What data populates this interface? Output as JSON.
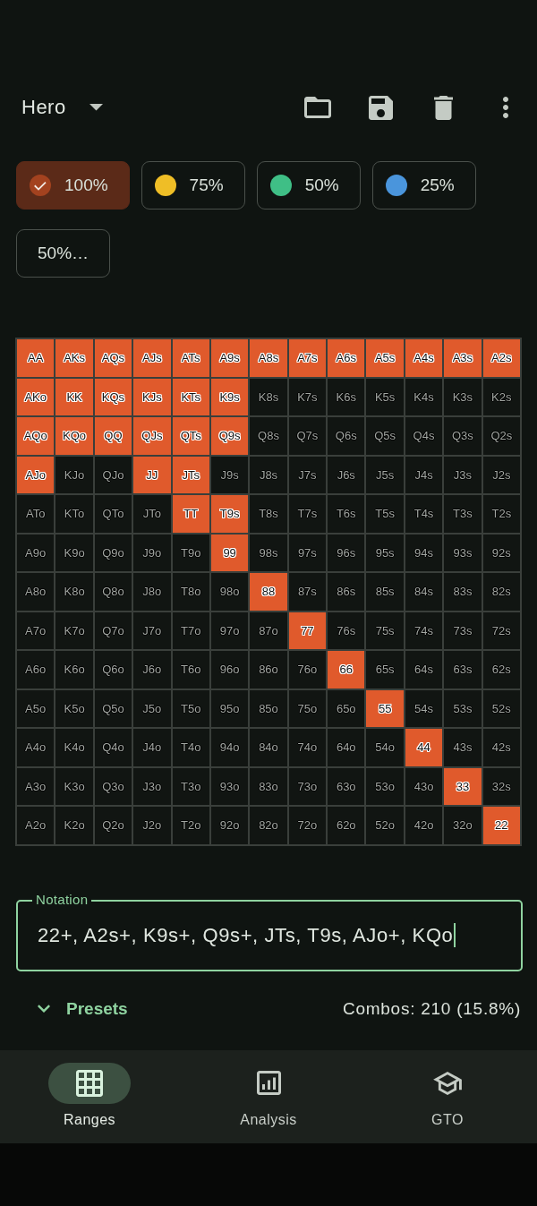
{
  "header": {
    "range_name": "Hero"
  },
  "chips": [
    {
      "label": "100%",
      "kind": "swatch",
      "color": "#a3421f",
      "selected": true
    },
    {
      "label": "75%",
      "kind": "swatch",
      "color": "#efbe26",
      "selected": false
    },
    {
      "label": "50%",
      "kind": "swatch",
      "color": "#3fbf86",
      "selected": false
    },
    {
      "label": "25%",
      "kind": "swatch",
      "color": "#4a95dc",
      "selected": false
    },
    {
      "label": "50%…",
      "kind": "plain",
      "selected": false
    }
  ],
  "range_grid": {
    "rows": [
      {
        "cells": [
          {
            "label": "AA",
            "selected": true
          },
          {
            "label": "AKs",
            "selected": true
          },
          {
            "label": "AQs",
            "selected": true
          },
          {
            "label": "AJs",
            "selected": true
          },
          {
            "label": "ATs",
            "selected": true
          },
          {
            "label": "A9s",
            "selected": true
          },
          {
            "label": "A8s",
            "selected": true
          },
          {
            "label": "A7s",
            "selected": true
          },
          {
            "label": "A6s",
            "selected": true
          },
          {
            "label": "A5s",
            "selected": true
          },
          {
            "label": "A4s",
            "selected": true
          },
          {
            "label": "A3s",
            "selected": true
          },
          {
            "label": "A2s",
            "selected": true
          }
        ]
      },
      {
        "cells": [
          {
            "label": "AKo",
            "selected": true
          },
          {
            "label": "KK",
            "selected": true
          },
          {
            "label": "KQs",
            "selected": true
          },
          {
            "label": "KJs",
            "selected": true
          },
          {
            "label": "KTs",
            "selected": true
          },
          {
            "label": "K9s",
            "selected": true
          },
          {
            "label": "K8s",
            "selected": false
          },
          {
            "label": "K7s",
            "selected": false
          },
          {
            "label": "K6s",
            "selected": false
          },
          {
            "label": "K5s",
            "selected": false
          },
          {
            "label": "K4s",
            "selected": false
          },
          {
            "label": "K3s",
            "selected": false
          },
          {
            "label": "K2s",
            "selected": false
          }
        ]
      },
      {
        "cells": [
          {
            "label": "AQo",
            "selected": true
          },
          {
            "label": "KQo",
            "selected": true
          },
          {
            "label": "QQ",
            "selected": true
          },
          {
            "label": "QJs",
            "selected": true
          },
          {
            "label": "QTs",
            "selected": true
          },
          {
            "label": "Q9s",
            "selected": true
          },
          {
            "label": "Q8s",
            "selected": false
          },
          {
            "label": "Q7s",
            "selected": false
          },
          {
            "label": "Q6s",
            "selected": false
          },
          {
            "label": "Q5s",
            "selected": false
          },
          {
            "label": "Q4s",
            "selected": false
          },
          {
            "label": "Q3s",
            "selected": false
          },
          {
            "label": "Q2s",
            "selected": false
          }
        ]
      },
      {
        "cells": [
          {
            "label": "AJo",
            "selected": true
          },
          {
            "label": "KJo",
            "selected": false
          },
          {
            "label": "QJo",
            "selected": false
          },
          {
            "label": "JJ",
            "selected": true
          },
          {
            "label": "JTs",
            "selected": true
          },
          {
            "label": "J9s",
            "selected": false
          },
          {
            "label": "J8s",
            "selected": false
          },
          {
            "label": "J7s",
            "selected": false
          },
          {
            "label": "J6s",
            "selected": false
          },
          {
            "label": "J5s",
            "selected": false
          },
          {
            "label": "J4s",
            "selected": false
          },
          {
            "label": "J3s",
            "selected": false
          },
          {
            "label": "J2s",
            "selected": false
          }
        ]
      },
      {
        "cells": [
          {
            "label": "ATo",
            "selected": false
          },
          {
            "label": "KTo",
            "selected": false
          },
          {
            "label": "QTo",
            "selected": false
          },
          {
            "label": "JTo",
            "selected": false
          },
          {
            "label": "TT",
            "selected": true
          },
          {
            "label": "T9s",
            "selected": true
          },
          {
            "label": "T8s",
            "selected": false
          },
          {
            "label": "T7s",
            "selected": false
          },
          {
            "label": "T6s",
            "selected": false
          },
          {
            "label": "T5s",
            "selected": false
          },
          {
            "label": "T4s",
            "selected": false
          },
          {
            "label": "T3s",
            "selected": false
          },
          {
            "label": "T2s",
            "selected": false
          }
        ]
      },
      {
        "cells": [
          {
            "label": "A9o",
            "selected": false
          },
          {
            "label": "K9o",
            "selected": false
          },
          {
            "label": "Q9o",
            "selected": false
          },
          {
            "label": "J9o",
            "selected": false
          },
          {
            "label": "T9o",
            "selected": false
          },
          {
            "label": "99",
            "selected": true
          },
          {
            "label": "98s",
            "selected": false
          },
          {
            "label": "97s",
            "selected": false
          },
          {
            "label": "96s",
            "selected": false
          },
          {
            "label": "95s",
            "selected": false
          },
          {
            "label": "94s",
            "selected": false
          },
          {
            "label": "93s",
            "selected": false
          },
          {
            "label": "92s",
            "selected": false
          }
        ]
      },
      {
        "cells": [
          {
            "label": "A8o",
            "selected": false
          },
          {
            "label": "K8o",
            "selected": false
          },
          {
            "label": "Q8o",
            "selected": false
          },
          {
            "label": "J8o",
            "selected": false
          },
          {
            "label": "T8o",
            "selected": false
          },
          {
            "label": "98o",
            "selected": false
          },
          {
            "label": "88",
            "selected": true
          },
          {
            "label": "87s",
            "selected": false
          },
          {
            "label": "86s",
            "selected": false
          },
          {
            "label": "85s",
            "selected": false
          },
          {
            "label": "84s",
            "selected": false
          },
          {
            "label": "83s",
            "selected": false
          },
          {
            "label": "82s",
            "selected": false
          }
        ]
      },
      {
        "cells": [
          {
            "label": "A7o",
            "selected": false
          },
          {
            "label": "K7o",
            "selected": false
          },
          {
            "label": "Q7o",
            "selected": false
          },
          {
            "label": "J7o",
            "selected": false
          },
          {
            "label": "T7o",
            "selected": false
          },
          {
            "label": "97o",
            "selected": false
          },
          {
            "label": "87o",
            "selected": false
          },
          {
            "label": "77",
            "selected": true
          },
          {
            "label": "76s",
            "selected": false
          },
          {
            "label": "75s",
            "selected": false
          },
          {
            "label": "74s",
            "selected": false
          },
          {
            "label": "73s",
            "selected": false
          },
          {
            "label": "72s",
            "selected": false
          }
        ]
      },
      {
        "cells": [
          {
            "label": "A6o",
            "selected": false
          },
          {
            "label": "K6o",
            "selected": false
          },
          {
            "label": "Q6o",
            "selected": false
          },
          {
            "label": "J6o",
            "selected": false
          },
          {
            "label": "T6o",
            "selected": false
          },
          {
            "label": "96o",
            "selected": false
          },
          {
            "label": "86o",
            "selected": false
          },
          {
            "label": "76o",
            "selected": false
          },
          {
            "label": "66",
            "selected": true
          },
          {
            "label": "65s",
            "selected": false
          },
          {
            "label": "64s",
            "selected": false
          },
          {
            "label": "63s",
            "selected": false
          },
          {
            "label": "62s",
            "selected": false
          }
        ]
      },
      {
        "cells": [
          {
            "label": "A5o",
            "selected": false
          },
          {
            "label": "K5o",
            "selected": false
          },
          {
            "label": "Q5o",
            "selected": false
          },
          {
            "label": "J5o",
            "selected": false
          },
          {
            "label": "T5o",
            "selected": false
          },
          {
            "label": "95o",
            "selected": false
          },
          {
            "label": "85o",
            "selected": false
          },
          {
            "label": "75o",
            "selected": false
          },
          {
            "label": "65o",
            "selected": false
          },
          {
            "label": "55",
            "selected": true
          },
          {
            "label": "54s",
            "selected": false
          },
          {
            "label": "53s",
            "selected": false
          },
          {
            "label": "52s",
            "selected": false
          }
        ]
      },
      {
        "cells": [
          {
            "label": "A4o",
            "selected": false
          },
          {
            "label": "K4o",
            "selected": false
          },
          {
            "label": "Q4o",
            "selected": false
          },
          {
            "label": "J4o",
            "selected": false
          },
          {
            "label": "T4o",
            "selected": false
          },
          {
            "label": "94o",
            "selected": false
          },
          {
            "label": "84o",
            "selected": false
          },
          {
            "label": "74o",
            "selected": false
          },
          {
            "label": "64o",
            "selected": false
          },
          {
            "label": "54o",
            "selected": false
          },
          {
            "label": "44",
            "selected": true
          },
          {
            "label": "43s",
            "selected": false
          },
          {
            "label": "42s",
            "selected": false
          }
        ]
      },
      {
        "cells": [
          {
            "label": "A3o",
            "selected": false
          },
          {
            "label": "K3o",
            "selected": false
          },
          {
            "label": "Q3o",
            "selected": false
          },
          {
            "label": "J3o",
            "selected": false
          },
          {
            "label": "T3o",
            "selected": false
          },
          {
            "label": "93o",
            "selected": false
          },
          {
            "label": "83o",
            "selected": false
          },
          {
            "label": "73o",
            "selected": false
          },
          {
            "label": "63o",
            "selected": false
          },
          {
            "label": "53o",
            "selected": false
          },
          {
            "label": "43o",
            "selected": false
          },
          {
            "label": "33",
            "selected": true
          },
          {
            "label": "32s",
            "selected": false
          }
        ]
      },
      {
        "cells": [
          {
            "label": "A2o",
            "selected": false
          },
          {
            "label": "K2o",
            "selected": false
          },
          {
            "label": "Q2o",
            "selected": false
          },
          {
            "label": "J2o",
            "selected": false
          },
          {
            "label": "T2o",
            "selected": false
          },
          {
            "label": "92o",
            "selected": false
          },
          {
            "label": "82o",
            "selected": false
          },
          {
            "label": "72o",
            "selected": false
          },
          {
            "label": "62o",
            "selected": false
          },
          {
            "label": "52o",
            "selected": false
          },
          {
            "label": "42o",
            "selected": false
          },
          {
            "label": "32o",
            "selected": false
          },
          {
            "label": "22",
            "selected": true
          }
        ]
      }
    ]
  },
  "notation": {
    "label": "Notation",
    "value": "22+, A2s+, K9s+, Q9s+, JTs, T9s, AJo+, KQo",
    "focused": true
  },
  "presets": {
    "label": "Presets",
    "expanded": false
  },
  "combos": "Combos: 210 (15.8%)",
  "bottom_nav": [
    {
      "label": "Ranges",
      "selected": true
    },
    {
      "label": "Analysis",
      "selected": false
    },
    {
      "label": "GTO",
      "selected": false
    }
  ]
}
